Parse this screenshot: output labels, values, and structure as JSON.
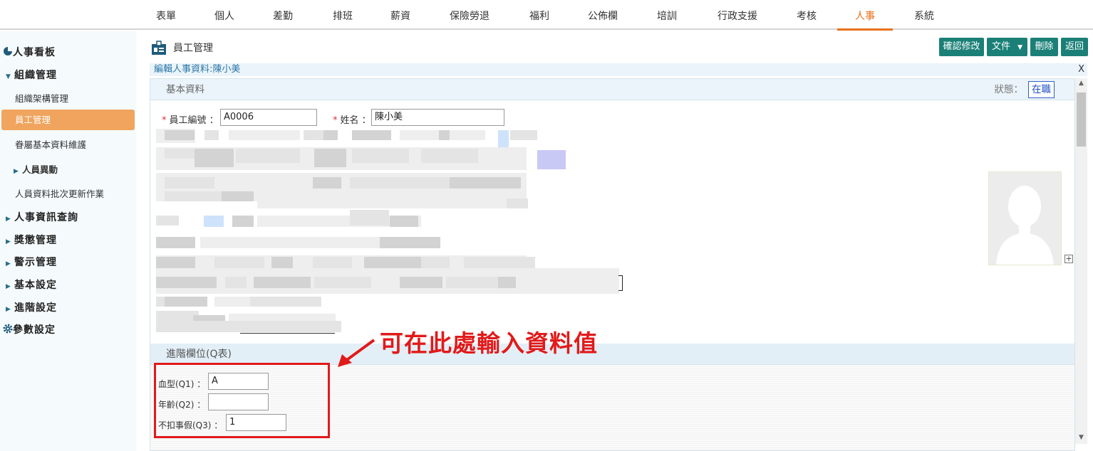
{
  "topnav": [
    "表單",
    "個人",
    "差勤",
    "排班",
    "薪資",
    "保險勞退",
    "福利",
    "公佈欄",
    "培訓",
    "行政支援",
    "考核",
    "人事",
    "系統"
  ],
  "active_tab": "人事",
  "sidebar": {
    "dashboard": "人事看板",
    "org_mgmt": "組織管理",
    "org_chart": "組織架構管理",
    "employee_mgmt": "員工管理",
    "dependents": "眷屬基本資料維護",
    "personnel_change": "人員異動",
    "batch_update": "人員資料批次更新作業",
    "hr_query": "人事資訊查詢",
    "rewards": "獎懲管理",
    "warnings": "警示管理",
    "basic_settings": "基本設定",
    "advanced_settings": "進階設定",
    "param_settings": "參數設定"
  },
  "header": {
    "title": "員工管理",
    "confirm": "確認修改",
    "document": "文件",
    "delete": "刪除",
    "back": "返回"
  },
  "edit_bar": {
    "title": "編輯人事資料:陳小美",
    "close": "X"
  },
  "basic": {
    "title": "基本資料",
    "status_label": "狀態：",
    "status_value": "在職",
    "emp_no_label": "員工編號",
    "emp_no_value": "A0006",
    "name_label": "姓名",
    "name_value": "陳小美"
  },
  "advanced": {
    "title": "進階欄位(Q表)",
    "q1_label": "血型(Q1)",
    "q1_value": "A",
    "q2_label": "年齡(Q2)",
    "q2_value": "",
    "q3_label": "不扣事假(Q3)",
    "q3_value": "1"
  },
  "annotation": "可在此處輸入資料值",
  "colors": {
    "accent": "#e8701a",
    "button": "#1a8077",
    "highlight": "#f0a45e",
    "annotation": "#e11a1a"
  },
  "icons": [
    "pie-chart-icon",
    "triangle-down-icon",
    "triangle-right-icon",
    "gear-icon",
    "id-card-icon",
    "caret-down-icon",
    "avatar-placeholder-icon",
    "plus-icon",
    "arrow-icon"
  ]
}
